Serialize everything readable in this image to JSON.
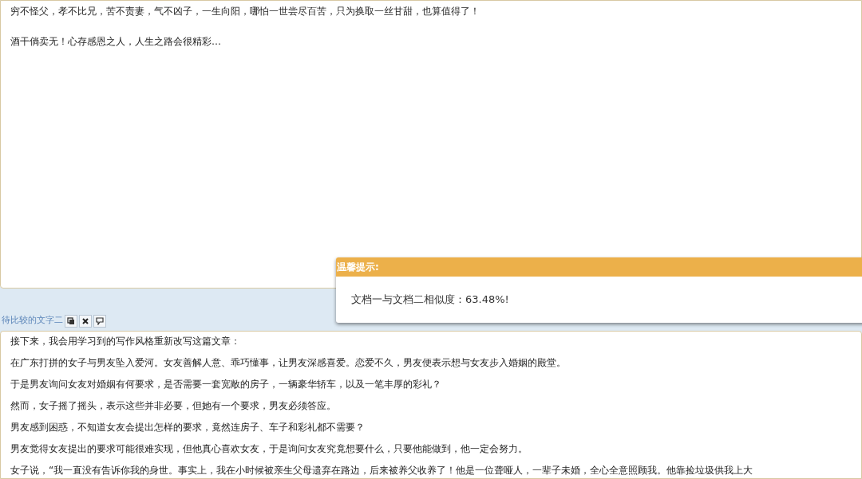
{
  "text_one": {
    "paragraphs": [
      "穷不怪父，孝不比兄，苦不责妻，气不凶子，一生向阳，哪怕一世尝尽百苦，只为换取一丝甘甜，也算值得了！",
      "酒干倘卖无！心存感恩之人，人生之路会很精彩…"
    ]
  },
  "text_two": {
    "label": "待比较的文字二",
    "lines": [
      "接下来，我会用学习到的写作风格重新改写这篇文章：",
      "在广东打拼的女子与男友坠入爱河。女友善解人意、乖巧懂事，让男友深感喜爱。恋爱不久，男友便表示想与女友步入婚姻的殿堂。",
      "于是男友询问女友对婚姻有何要求，是否需要一套宽敞的房子，一辆豪华轿车，以及一笔丰厚的彩礼？",
      "然而，女子摇了摇头，表示这些并非必要，但她有一个要求，男友必须答应。",
      "男友感到困惑，不知道女友会提出怎样的要求，竟然连房子、车子和彩礼都不需要？",
      "男友觉得女友提出的要求可能很难实现，但他真心喜欢女友，于是询问女友究竟想要什么，只要他能做到，他一定会努力。",
      "女子说，“我一直没有告诉你我的身世。事实上，我在小时候被亲生父母遗弃在路边，后来被养父收养了！他是一位聋哑人，一辈子未婚，全心全意照顾我。他靠捡垃圾供我上大"
    ]
  },
  "dialog": {
    "title": "温馨提示:",
    "message": "文档一与文档二相似度：63.48%!"
  }
}
